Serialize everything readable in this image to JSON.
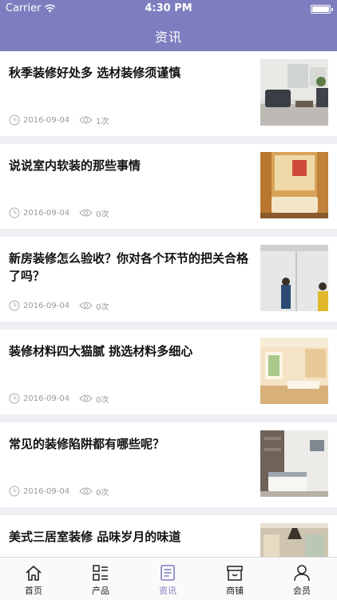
{
  "status_bar": {
    "carrier": "Carrier",
    "time": "4:30 PM"
  },
  "nav": {
    "title": "资讯"
  },
  "articles": [
    {
      "title": "秋季装修好处多 选材装修须谨慎",
      "date": "2016-09-04",
      "views": "1次"
    },
    {
      "title": "说说室内软装的那些事情",
      "date": "2016-09-04",
      "views": "0次"
    },
    {
      "title": "新房装修怎么验收？你对各个环节的把关合格了吗？",
      "date": "2016-09-04",
      "views": "0次"
    },
    {
      "title": "装修材料四大猫腻 挑选材料多细心",
      "date": "2016-09-04",
      "views": "0次"
    },
    {
      "title": "常见的装修陷阱都有哪些呢？",
      "date": "2016-09-04",
      "views": "0次"
    },
    {
      "title": "美式三居室装修 品味岁月的味道",
      "date": "",
      "views": ""
    }
  ],
  "tabbar": {
    "items": [
      {
        "label": "首页",
        "icon": "home-icon"
      },
      {
        "label": "产品",
        "icon": "list-icon"
      },
      {
        "label": "资讯",
        "icon": "news-icon",
        "active": true
      },
      {
        "label": "商铺",
        "icon": "shop-icon"
      },
      {
        "label": "会员",
        "icon": "user-icon"
      }
    ]
  },
  "colors": {
    "accent": "#7e7dbf",
    "background": "#efeff4",
    "meta_text": "#999999"
  }
}
